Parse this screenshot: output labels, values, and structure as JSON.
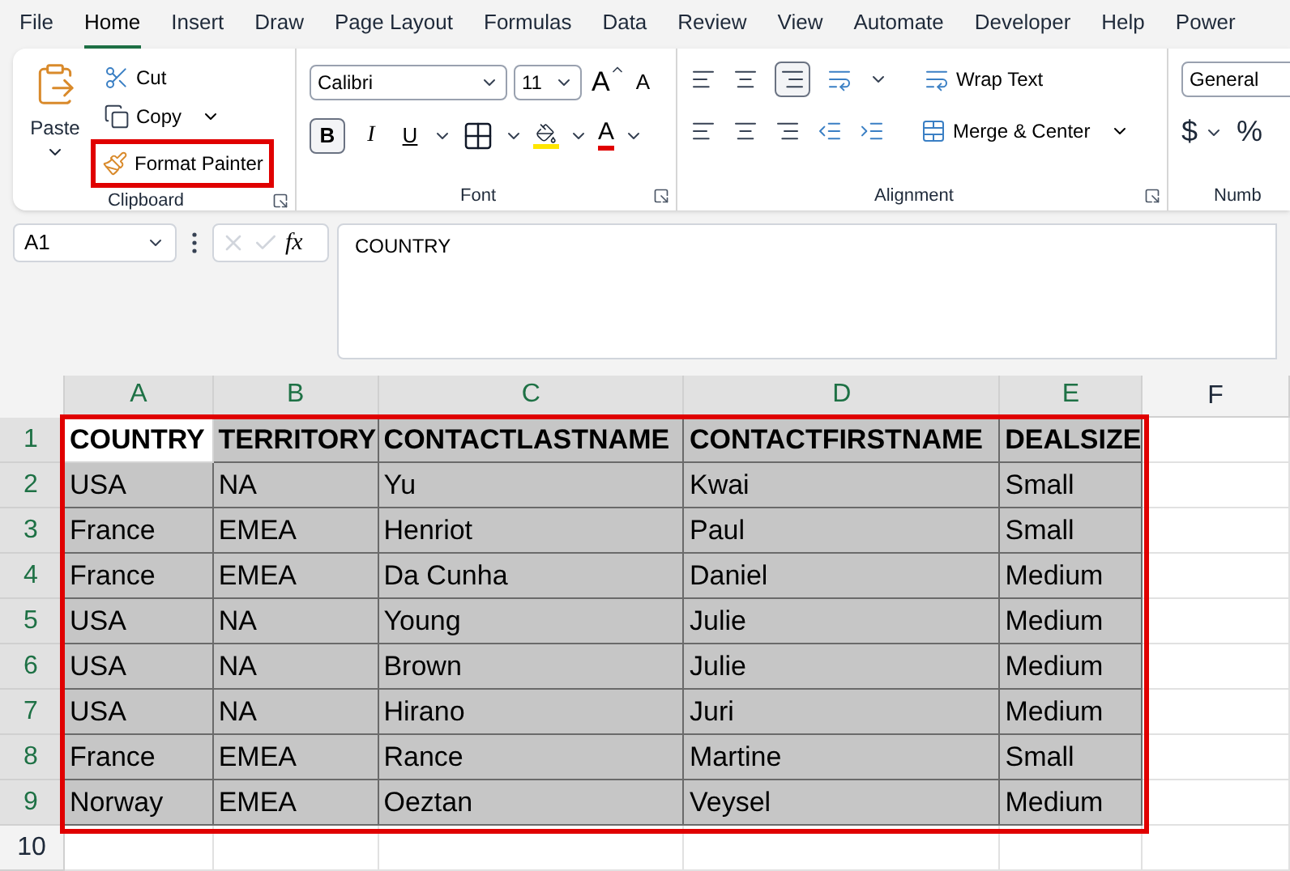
{
  "tabs": [
    {
      "label": "File",
      "selected": false
    },
    {
      "label": "Home",
      "selected": true
    },
    {
      "label": "Insert",
      "selected": false
    },
    {
      "label": "Draw",
      "selected": false
    },
    {
      "label": "Page Layout",
      "selected": false
    },
    {
      "label": "Formulas",
      "selected": false
    },
    {
      "label": "Data",
      "selected": false
    },
    {
      "label": "Review",
      "selected": false
    },
    {
      "label": "View",
      "selected": false
    },
    {
      "label": "Automate",
      "selected": false
    },
    {
      "label": "Developer",
      "selected": false
    },
    {
      "label": "Help",
      "selected": false
    },
    {
      "label": "Power",
      "selected": false
    }
  ],
  "clipboard": {
    "group": "Clipboard",
    "paste": "Paste",
    "cut": "Cut",
    "copy": "Copy",
    "format_painter": {
      "label": "Format Painter",
      "highlighted": true
    }
  },
  "font": {
    "group": "Font",
    "name": "Calibri",
    "size": "11",
    "grow": "A",
    "shrink": "A",
    "bold": "B",
    "italic": "I",
    "underline": "U",
    "font_color": "A"
  },
  "alignment": {
    "group": "Alignment",
    "wrap": "Wrap Text",
    "merge": "Merge & Center"
  },
  "number": {
    "group": "Numb",
    "format": "General",
    "currency": "$",
    "percent": "%"
  },
  "name_box": "A1",
  "fx": "fx",
  "formula": "COUNTRY",
  "sheet": {
    "highlighted": true,
    "columns": [
      {
        "label": "A",
        "selected": true
      },
      {
        "label": "B",
        "selected": true
      },
      {
        "label": "C",
        "selected": true
      },
      {
        "label": "D",
        "selected": true
      },
      {
        "label": "E",
        "selected": true
      },
      {
        "label": "F",
        "selected": false
      }
    ],
    "rows": [
      {
        "number": "1",
        "selected": true,
        "header": true,
        "cells": [
          {
            "text": "COUNTRY",
            "active": true
          },
          {
            "text": "TERRITORY",
            "active": false
          },
          {
            "text": "CONTACTLASTNAME",
            "active": false
          },
          {
            "text": "CONTACTFIRSTNAME",
            "active": false
          },
          {
            "text": "DEALSIZE",
            "active": false
          }
        ]
      },
      {
        "number": "2",
        "selected": true,
        "header": false,
        "cells": [
          {
            "text": "USA",
            "active": false
          },
          {
            "text": "NA",
            "active": false
          },
          {
            "text": "Yu",
            "active": false
          },
          {
            "text": "Kwai",
            "active": false
          },
          {
            "text": "Small",
            "active": false
          }
        ]
      },
      {
        "number": "3",
        "selected": true,
        "header": false,
        "cells": [
          {
            "text": "France",
            "active": false
          },
          {
            "text": "EMEA",
            "active": false
          },
          {
            "text": "Henriot",
            "active": false
          },
          {
            "text": "Paul",
            "active": false
          },
          {
            "text": "Small",
            "active": false
          }
        ]
      },
      {
        "number": "4",
        "selected": true,
        "header": false,
        "cells": [
          {
            "text": "France",
            "active": false
          },
          {
            "text": "EMEA",
            "active": false
          },
          {
            "text": "Da Cunha",
            "active": false
          },
          {
            "text": "Daniel",
            "active": false
          },
          {
            "text": "Medium",
            "active": false
          }
        ]
      },
      {
        "number": "5",
        "selected": true,
        "header": false,
        "cells": [
          {
            "text": "USA",
            "active": false
          },
          {
            "text": "NA",
            "active": false
          },
          {
            "text": "Young",
            "active": false
          },
          {
            "text": "Julie",
            "active": false
          },
          {
            "text": "Medium",
            "active": false
          }
        ]
      },
      {
        "number": "6",
        "selected": true,
        "header": false,
        "cells": [
          {
            "text": "USA",
            "active": false
          },
          {
            "text": "NA",
            "active": false
          },
          {
            "text": "Brown",
            "active": false
          },
          {
            "text": "Julie",
            "active": false
          },
          {
            "text": "Medium",
            "active": false
          }
        ]
      },
      {
        "number": "7",
        "selected": true,
        "header": false,
        "cells": [
          {
            "text": "USA",
            "active": false
          },
          {
            "text": "NA",
            "active": false
          },
          {
            "text": "Hirano",
            "active": false
          },
          {
            "text": "Juri",
            "active": false
          },
          {
            "text": "Medium",
            "active": false
          }
        ]
      },
      {
        "number": "8",
        "selected": true,
        "header": false,
        "cells": [
          {
            "text": "France",
            "active": false
          },
          {
            "text": "EMEA",
            "active": false
          },
          {
            "text": "Rance",
            "active": false
          },
          {
            "text": "Martine",
            "active": false
          },
          {
            "text": "Small",
            "active": false
          }
        ]
      },
      {
        "number": "9",
        "selected": true,
        "header": false,
        "cells": [
          {
            "text": "Norway",
            "active": false
          },
          {
            "text": "EMEA",
            "active": false
          },
          {
            "text": "Oeztan",
            "active": false
          },
          {
            "text": "Veysel",
            "active": false
          },
          {
            "text": "Medium",
            "active": false
          }
        ]
      },
      {
        "number": "10",
        "selected": false
      }
    ]
  }
}
